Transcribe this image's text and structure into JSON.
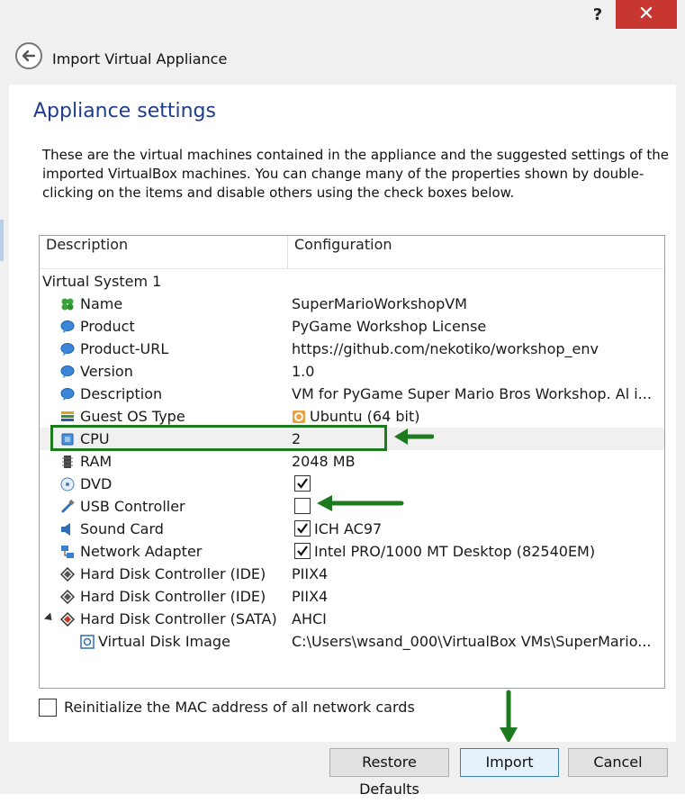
{
  "window": {
    "help_label": "?",
    "close_label": "✕",
    "title": "Import Virtual Appliance"
  },
  "page": {
    "title": "Appliance settings",
    "intro": "These are the virtual machines contained in the appliance and the suggested settings of the imported VirtualBox machines. You can change many of the properties shown by double-clicking on the items and disable others using the check boxes below."
  },
  "table": {
    "headers": {
      "description": "Description",
      "configuration": "Configuration"
    },
    "group": "Virtual System 1",
    "rows": [
      {
        "label": "Name",
        "value": "SuperMarioWorkshopVM",
        "icon": "name-icon"
      },
      {
        "label": "Product",
        "value": "PyGame Workshop License",
        "icon": "product-icon"
      },
      {
        "label": "Product-URL",
        "value": "https://github.com/nekotiko/workshop_env",
        "icon": "product-url-icon"
      },
      {
        "label": "Version",
        "value": "1.0",
        "icon": "version-icon"
      },
      {
        "label": "Description",
        "value": "VM for PyGame Super Mario Bros Workshop. Al i...",
        "icon": "description-icon"
      },
      {
        "label": "Guest OS Type",
        "value": "Ubuntu (64 bit)",
        "icon": "guest-os-icon"
      },
      {
        "label": "CPU",
        "value": "2",
        "icon": "cpu-icon"
      },
      {
        "label": "RAM",
        "value": "2048 MB",
        "icon": "ram-icon"
      },
      {
        "label": "DVD",
        "value": "",
        "icon": "dvd-icon",
        "checked": true
      },
      {
        "label": "USB Controller",
        "value": "",
        "icon": "usb-icon",
        "checked": false
      },
      {
        "label": "Sound Card",
        "value": "ICH AC97",
        "icon": "sound-card-icon",
        "checked": true
      },
      {
        "label": "Network Adapter",
        "value": "Intel PRO/1000 MT Desktop (82540EM)",
        "icon": "network-adapter-icon",
        "checked": true
      },
      {
        "label": "Hard Disk Controller (IDE)",
        "value": "PIIX4",
        "icon": "ide-controller-icon"
      },
      {
        "label": "Hard Disk Controller (IDE)",
        "value": "PIIX4",
        "icon": "ide-controller-icon"
      },
      {
        "label": "Hard Disk Controller (SATA)",
        "value": "AHCI",
        "icon": "sata-controller-icon",
        "expanded": true
      },
      {
        "label": "Virtual Disk Image",
        "value": "C:\\Users\\wsand_000\\VirtualBox VMs\\SuperMario...",
        "icon": "disk-image-icon"
      }
    ]
  },
  "options": {
    "reinit_mac_label": "Reinitialize the MAC address of all network cards",
    "reinit_mac_checked": false
  },
  "buttons": {
    "restore_defaults": "Restore Defaults",
    "import": "Import",
    "cancel": "Cancel"
  },
  "colors": {
    "title_blue": "#1f3d8c",
    "close_red": "#c7372f",
    "annotation_green": "#1e7a1e"
  }
}
